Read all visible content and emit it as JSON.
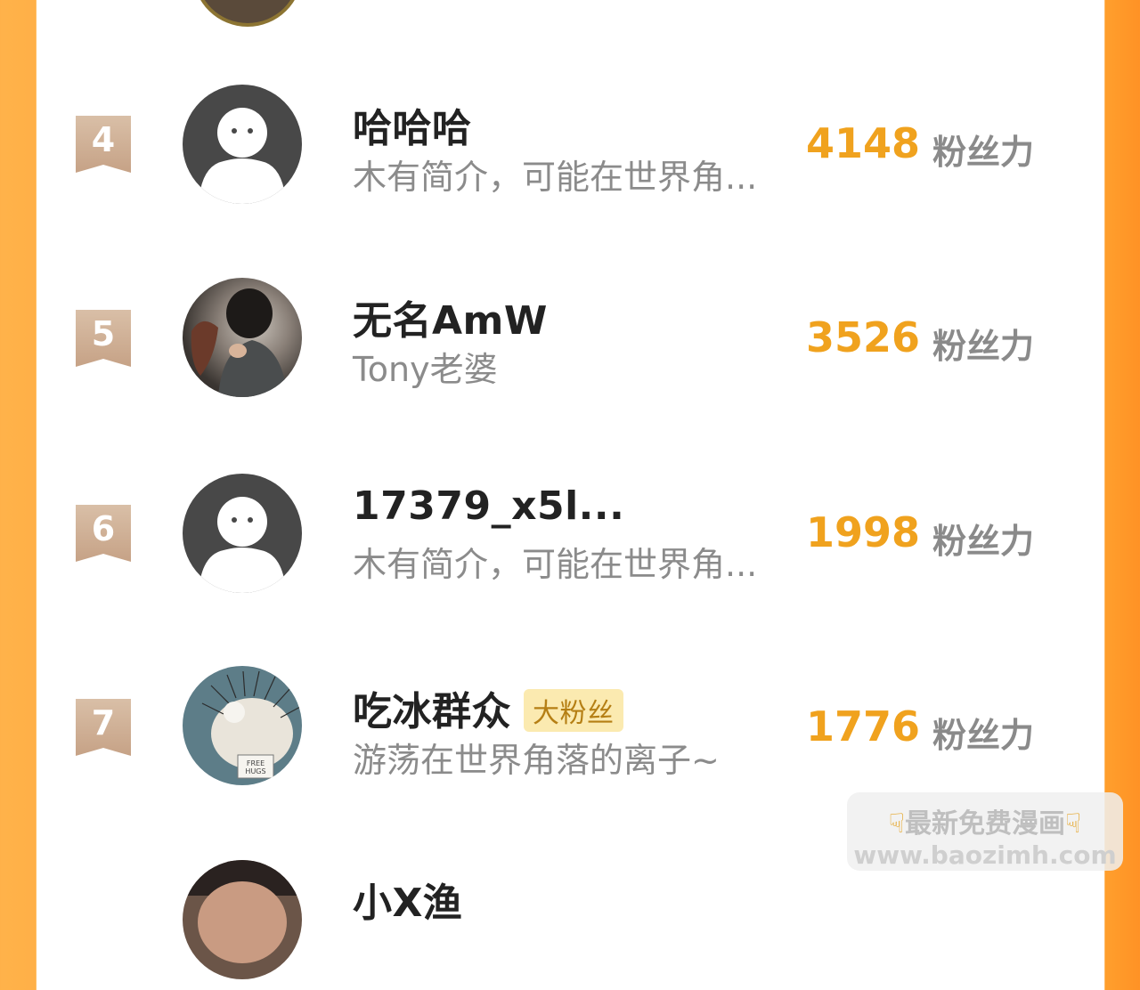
{
  "colors": {
    "accent": "#f0a21e",
    "frame_left": "#ffb24a",
    "frame_right": "#ff9a29",
    "badge_bg": "#fbeab0"
  },
  "rows": [
    {
      "rank": "4",
      "name": "哈哈哈",
      "bio": "木有简介，可能在世界角...",
      "score": "4148",
      "unit": "粉丝力",
      "avatar": "default-avatar-icon"
    },
    {
      "rank": "5",
      "name": "无名AmW",
      "bio": "Tony老婆",
      "score": "3526",
      "unit": "粉丝力",
      "avatar": "user-photo"
    },
    {
      "rank": "6",
      "name": "17379_x5l...",
      "bio": "木有简介，可能在世界角...",
      "score": "1998",
      "unit": "粉丝力",
      "avatar": "default-avatar-icon"
    },
    {
      "rank": "7",
      "name": "吃冰群众",
      "badge": "大粉丝",
      "bio": "游荡在世界角落的离子~",
      "score": "1776",
      "unit": "粉丝力",
      "avatar": "free-hugs-illustration",
      "avatar_text": "FREE HUGS"
    },
    {
      "name": "小X渔",
      "avatar": "user-photo"
    }
  ],
  "watermark": {
    "line1": "最新免费漫画",
    "line2": "www.baozimh.com",
    "icon": "pointing-down-hand-icon"
  }
}
